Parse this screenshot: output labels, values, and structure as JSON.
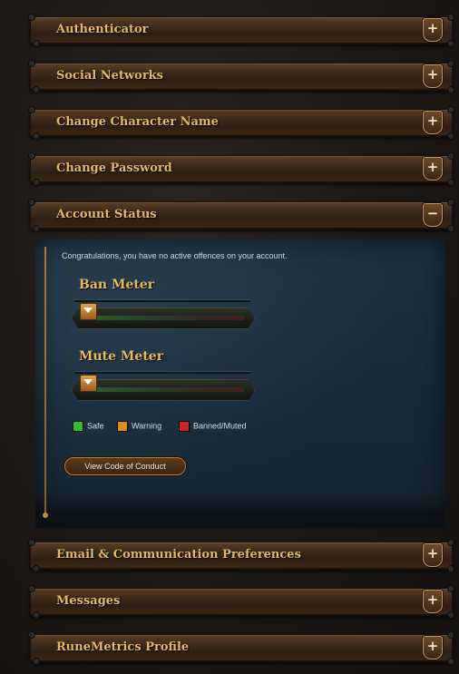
{
  "sections": [
    {
      "title": "Authenticator",
      "toggle": "+"
    },
    {
      "title": "Social Networks",
      "toggle": "+"
    },
    {
      "title": "Change Character Name",
      "toggle": "+"
    },
    {
      "title": "Change Password",
      "toggle": "+"
    },
    {
      "title": "Account Status",
      "toggle": "−"
    },
    {
      "title": "Email & Communication Preferences",
      "toggle": "+"
    },
    {
      "title": "Messages",
      "toggle": "+"
    },
    {
      "title": "RuneMetrics Profile",
      "toggle": "+"
    }
  ],
  "account_status": {
    "notice": "Congratulations, you have no active offences on your account.",
    "ban_meter": {
      "title": "Ban Meter",
      "level": 0
    },
    "mute_meter": {
      "title": "Mute Meter",
      "level": 0
    },
    "legend": [
      {
        "label": "Safe",
        "color": "#2fbf2a"
      },
      {
        "label": "Warning",
        "color": "#e08a1a"
      },
      {
        "label": "Banned/Muted",
        "color": "#d02222"
      }
    ],
    "conduct_button": "View Code of Conduct"
  }
}
